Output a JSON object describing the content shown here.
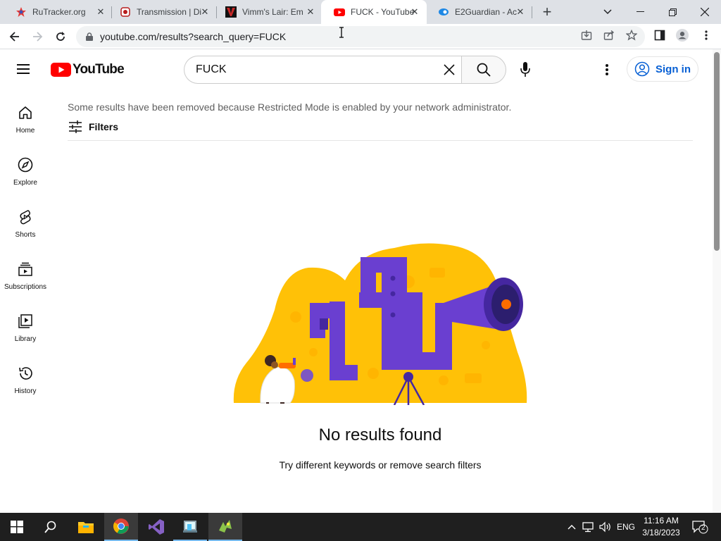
{
  "browser": {
    "tabs": [
      {
        "title": "RuTracker.org",
        "favicon": "rutracker-icon"
      },
      {
        "title": "Transmission | Di",
        "favicon": "transmission-icon"
      },
      {
        "title": "Vimm's Lair: Em",
        "favicon": "vimm-icon"
      },
      {
        "title": "FUCK - YouTube",
        "favicon": "youtube-icon",
        "active": true
      },
      {
        "title": "E2Guardian - Ac",
        "favicon": "e2guardian-icon"
      }
    ],
    "url": "youtube.com/results?search_query=FUCK"
  },
  "youtube": {
    "logo_text": "YouTube",
    "search": {
      "value": "FUCK",
      "placeholder": "Search"
    },
    "sign_in_label": "Sign in",
    "guide": [
      {
        "label": "Home",
        "icon": "home-icon"
      },
      {
        "label": "Explore",
        "icon": "compass-icon"
      },
      {
        "label": "Shorts",
        "icon": "shorts-icon"
      },
      {
        "label": "Subscriptions",
        "icon": "subscriptions-icon"
      },
      {
        "label": "Library",
        "icon": "library-icon"
      },
      {
        "label": "History",
        "icon": "history-icon"
      }
    ],
    "restricted_notice": "Some results have been removed because Restricted Mode is enabled by your network administrator.",
    "filters_label": "Filters",
    "no_results_title": "No results found",
    "no_results_hint": "Try different keywords or remove search filters",
    "colors": {
      "brand_red": "#ff0000",
      "link_blue": "#065fd4",
      "illus_yellow": "#ffc107",
      "illus_purple": "#6a3fd0"
    }
  },
  "taskbar": {
    "apps": [
      "start-icon",
      "search-icon",
      "file-explorer-icon",
      "chrome-icon",
      "visual-studio-icon",
      "app-icon",
      "game-icon"
    ],
    "language": "ENG",
    "time": "11:16 AM",
    "date": "3/18/2023",
    "notifications": "2"
  }
}
